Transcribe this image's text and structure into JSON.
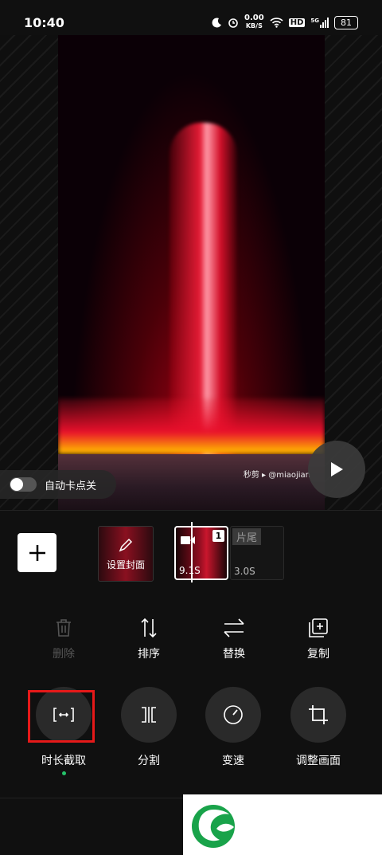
{
  "status": {
    "time": "10:40",
    "net_speed": "0.00",
    "net_unit": "KB/S",
    "hd": "HD",
    "signal_label": "5G",
    "battery": "81"
  },
  "preview": {
    "watermark": "秒剪 ▸ @miaojian",
    "auto_beat_label": "自动卡点关"
  },
  "timeline": {
    "cover_label": "设置封面",
    "clip_index": "1",
    "clip_duration": "9.1S",
    "outro_label": "片尾",
    "outro_duration": "3.0S"
  },
  "tools": [
    {
      "label": "删除",
      "icon": "trash-icon",
      "enabled": false
    },
    {
      "label": "排序",
      "icon": "sort-icon",
      "enabled": true
    },
    {
      "label": "替换",
      "icon": "swap-icon",
      "enabled": true
    },
    {
      "label": "复制",
      "icon": "copy-icon",
      "enabled": true
    }
  ],
  "actions": [
    {
      "label": "时长截取",
      "icon": "trim-icon",
      "active": true
    },
    {
      "label": "分割",
      "icon": "split-icon"
    },
    {
      "label": "变速",
      "icon": "speed-icon"
    },
    {
      "label": "调整画面",
      "icon": "crop-icon"
    }
  ],
  "colors": {
    "background": "#101010",
    "highlight": "#e61919",
    "active_dot": "#25c26a",
    "logo_green": "#19a34a"
  }
}
